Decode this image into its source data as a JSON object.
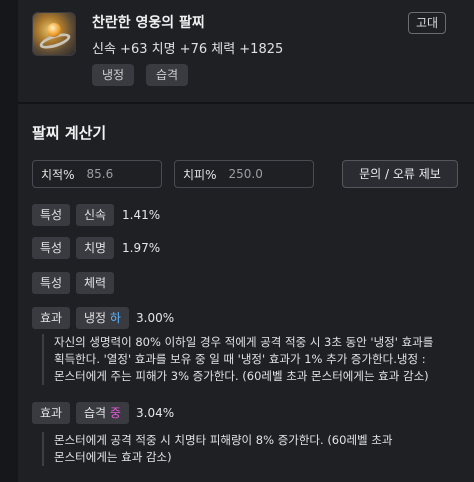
{
  "item": {
    "title": "찬란한 영웅의 팔찌",
    "grade": "고대",
    "stats": "신속 +63  치명 +76  체력 +1825",
    "chips": [
      "냉정",
      "습격"
    ]
  },
  "calculator": {
    "title": "팔찌 계산기",
    "inputs": [
      {
        "label": "치적%",
        "value": "85.6"
      },
      {
        "label": "치피%",
        "value": "250.0"
      }
    ],
    "report_button": "문의 / 오류 제보"
  },
  "rows": [
    {
      "kind": "특성",
      "name": "신속",
      "value": "1.41%"
    },
    {
      "kind": "특성",
      "name": "치명",
      "value": "1.97%"
    },
    {
      "kind": "특성",
      "name": "체력",
      "value": ""
    },
    {
      "kind": "효과",
      "name": "냉정",
      "level": "하",
      "value": "3.00%",
      "desc_lines": [
        "자신의 생명력이 80% 이하일 경우 적에게 공격 적중 시 3초 동안 '냉정' 효과를",
        "획득한다. '열정' 효과를 보유 중 일 때 '냉정' 효과가 1% 추가 증가한다.냉정 :",
        "몬스터에게 주는 피해가 3% 증가한다. (60레벨 초과 몬스터에게는 효과 감소)"
      ]
    },
    {
      "kind": "효과",
      "name": "습격",
      "level": "중",
      "value": "3.04%",
      "desc_lines": [
        "몬스터에게 공격 적중 시 치명타 피해량이 8% 증가한다. (60레벨 초과",
        "몬스터에게는 효과 감소)"
      ]
    }
  ],
  "colors": {
    "level_low": "#59b4ff",
    "level_mid": "#e55ad8"
  }
}
